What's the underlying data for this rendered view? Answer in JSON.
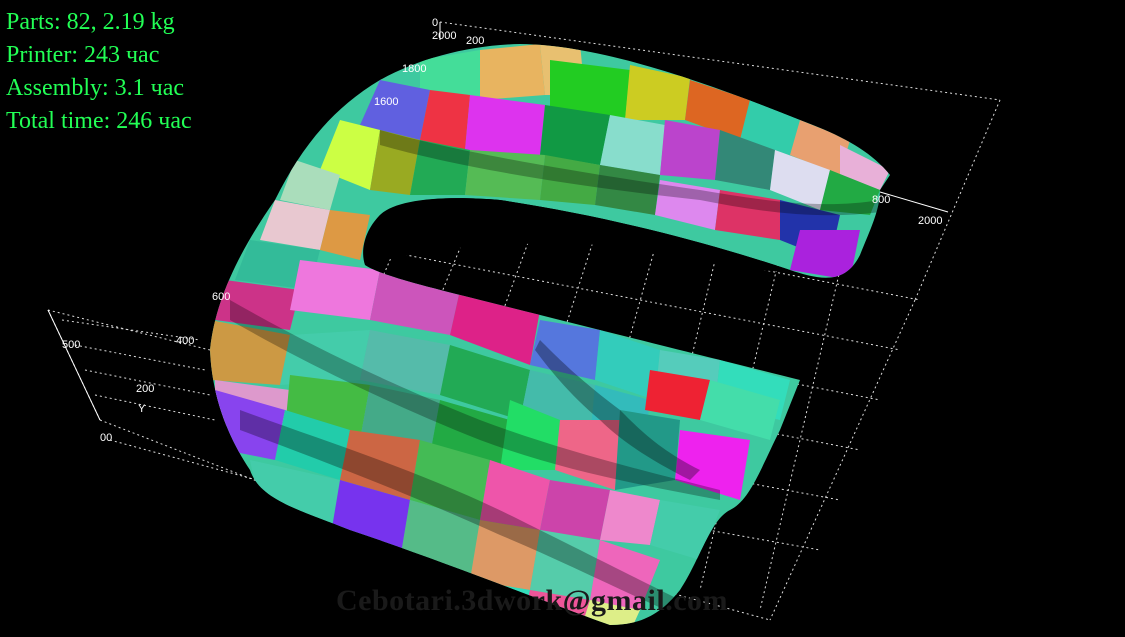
{
  "hud": {
    "parts": "Parts: 82, 2.19 kg",
    "printer": "Printer: 243 час",
    "assembly": "Assembly: 3.1 час",
    "total_time": "Total time: 246 час"
  },
  "axes": {
    "top_0": "0",
    "top_2000": "2000",
    "top_200": "200",
    "top_1800": "1800",
    "top_1600": "1600",
    "right_800": "800",
    "right_2000": "2000",
    "left_500": "500",
    "left_600": "600",
    "left_400": "400",
    "left_200": "200",
    "left_y": "Y",
    "origin": "00"
  },
  "watermark": "Cebotari.3dwork@gmail.com",
  "colors": {
    "background": "#000000",
    "hud_text": "#22ff55",
    "grid": "#ffffff"
  }
}
